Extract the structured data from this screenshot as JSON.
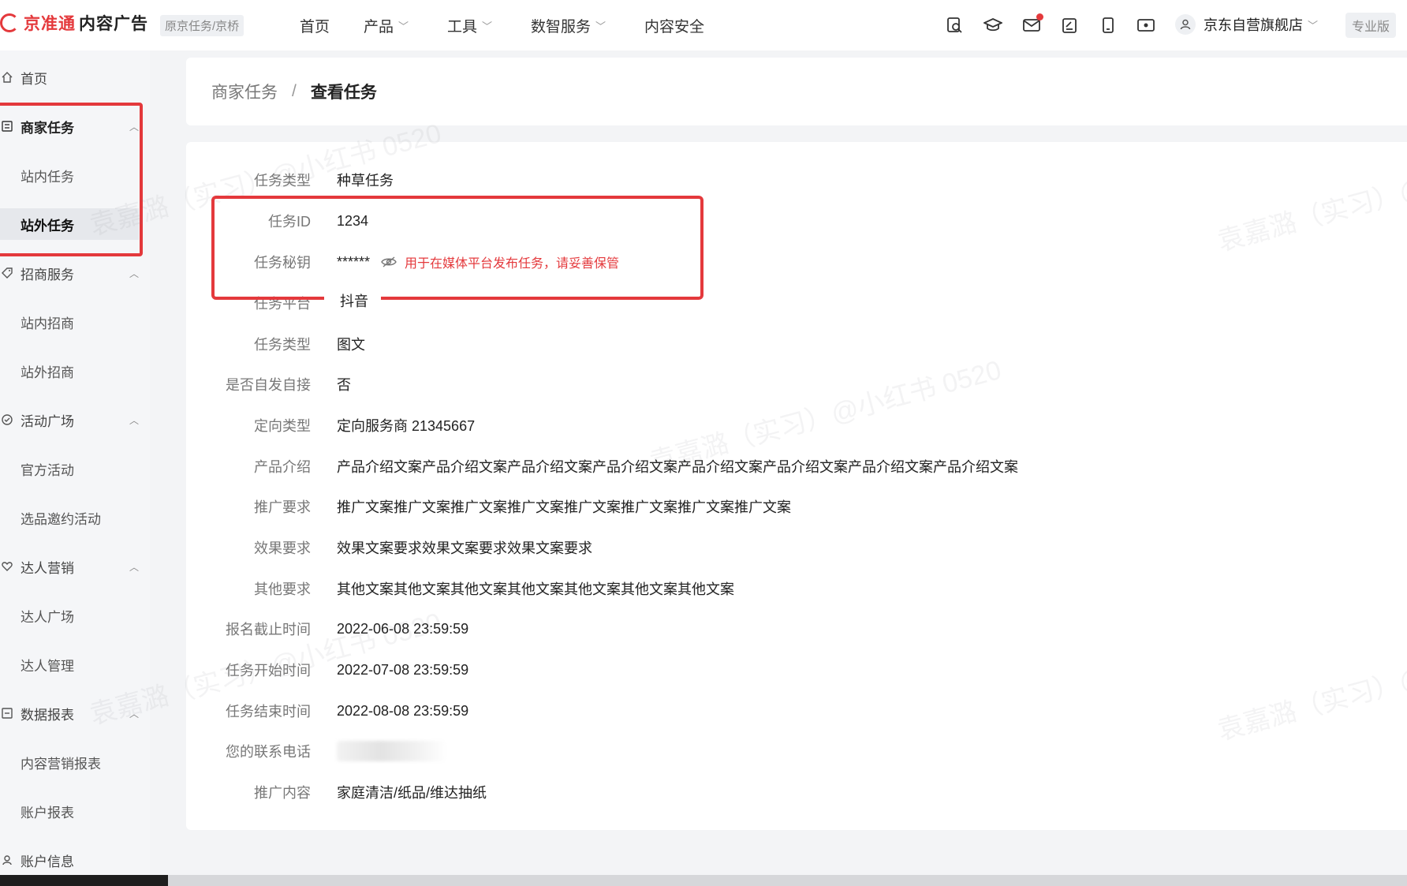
{
  "brand": {
    "name_red": "京准通",
    "name_dark": "内容广告",
    "tenant_tag": "原京任务/京桥",
    "accent_color": "#e4393c"
  },
  "top_nav": [
    {
      "label": "首页",
      "has_dropdown": false
    },
    {
      "label": "产品",
      "has_dropdown": true
    },
    {
      "label": "工具",
      "has_dropdown": true
    },
    {
      "label": "数智服务",
      "has_dropdown": true
    },
    {
      "label": "内容安全",
      "has_dropdown": false
    }
  ],
  "header_icons": [
    "search-doc-icon",
    "graduation-cap-icon",
    "mail-icon",
    "edit-note-icon",
    "mobile-icon",
    "screen-icon"
  ],
  "account": {
    "store_name": "京东自营旗舰店",
    "edition": "专业版"
  },
  "sidebar": {
    "home": "首页",
    "groups": [
      {
        "label": "商家任务",
        "items": [
          "站内任务",
          "站外任务"
        ]
      },
      {
        "label": "招商服务",
        "items": [
          "站内招商",
          "站外招商"
        ]
      },
      {
        "label": "活动广场",
        "items": [
          "官方活动",
          "选品邀约活动"
        ]
      },
      {
        "label": "达人营销",
        "items": [
          "达人广场",
          "达人管理"
        ]
      },
      {
        "label": "数据报表",
        "items": [
          "内容营销报表",
          "账户报表"
        ]
      }
    ],
    "account_info": "账户信息",
    "active_item": "站外任务"
  },
  "breadcrumb": {
    "parent": "商家任务",
    "separator": "/",
    "current": "查看任务"
  },
  "detail": {
    "fields": [
      {
        "label": "任务类型",
        "value": "种草任务"
      },
      {
        "label": "任务ID",
        "value": "1234"
      },
      {
        "label": "任务秘钥",
        "value": "******",
        "hint": "用于在媒体平台发布任务，请妥善保管"
      },
      {
        "label": "任务平台",
        "value": "抖音"
      },
      {
        "label": "任务类型",
        "value": "图文"
      },
      {
        "label": "是否自发自接",
        "value": "否"
      },
      {
        "label": "定向类型",
        "value": "定向服务商 21345667"
      },
      {
        "label": "产品介绍",
        "value": "产品介绍文案产品介绍文案产品介绍文案产品介绍文案产品介绍文案产品介绍文案产品介绍文案产品介绍文案"
      },
      {
        "label": "推广要求",
        "value": "推广文案推广文案推广文案推广文案推广文案推广文案推广文案推广文案"
      },
      {
        "label": "效果要求",
        "value": "效果文案要求效果文案要求效果文案要求"
      },
      {
        "label": "其他要求",
        "value": "其他文案其他文案其他文案其他文案其他文案其他文案其他文案"
      },
      {
        "label": "报名截止时间",
        "value": "2022-06-08 23:59:59"
      },
      {
        "label": "任务开始时间",
        "value": "2022-07-08 23:59:59"
      },
      {
        "label": "任务结束时间",
        "value": "2022-08-08 23:59:59"
      },
      {
        "label": "您的联系电话",
        "value": ""
      },
      {
        "label": "推广内容",
        "value": "家庭清洁/纸品/维达抽纸"
      }
    ]
  },
  "watermark": {
    "text": "袁嘉潞（实习）@小红书 0520"
  }
}
